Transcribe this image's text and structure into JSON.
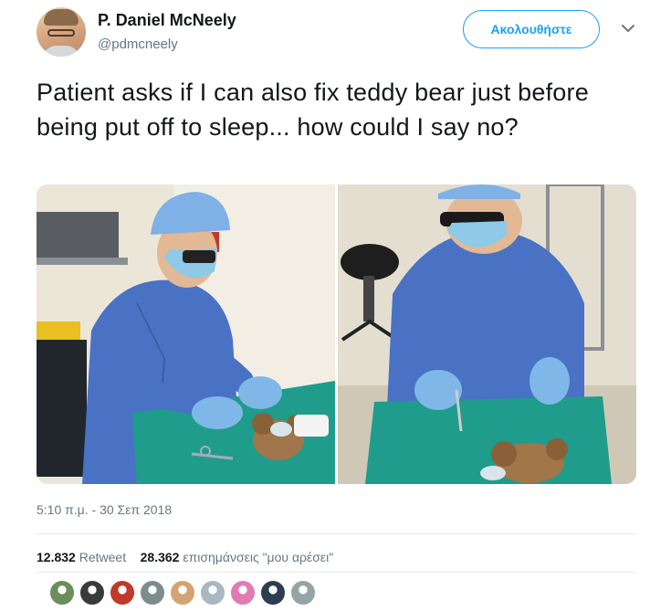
{
  "author": {
    "name": "P. Daniel McNeely",
    "handle": "@pdmcneely"
  },
  "follow_label": "Ακολουθήστε",
  "tweet_text": "Patient asks if I can also fix teddy bear just before being put off to sleep... how could I say no?",
  "timestamp": "5:10 π.μ. - 30 Σεπ 2018",
  "stats": {
    "retweets_count": "12.832",
    "retweets_label": "Retweet",
    "likes_count": "28.362",
    "likes_label": "επισημάνσεις \"μου αρέσει\""
  },
  "icons": {
    "more": "chevron-down-icon"
  },
  "colors": {
    "accent": "#1da1f2",
    "scrubs": "#4a72c4",
    "drape": "#1f9c8c",
    "glove": "#7fb8e8"
  },
  "likers": [
    {
      "color": "#6b8e5a"
    },
    {
      "color": "#3a3a3a"
    },
    {
      "color": "#c0392b"
    },
    {
      "color": "#7f8c8d"
    },
    {
      "color": "#d4a373"
    },
    {
      "color": "#aab8c2"
    },
    {
      "color": "#e07bb5"
    },
    {
      "color": "#2c3e50"
    },
    {
      "color": "#95a5a6"
    }
  ]
}
